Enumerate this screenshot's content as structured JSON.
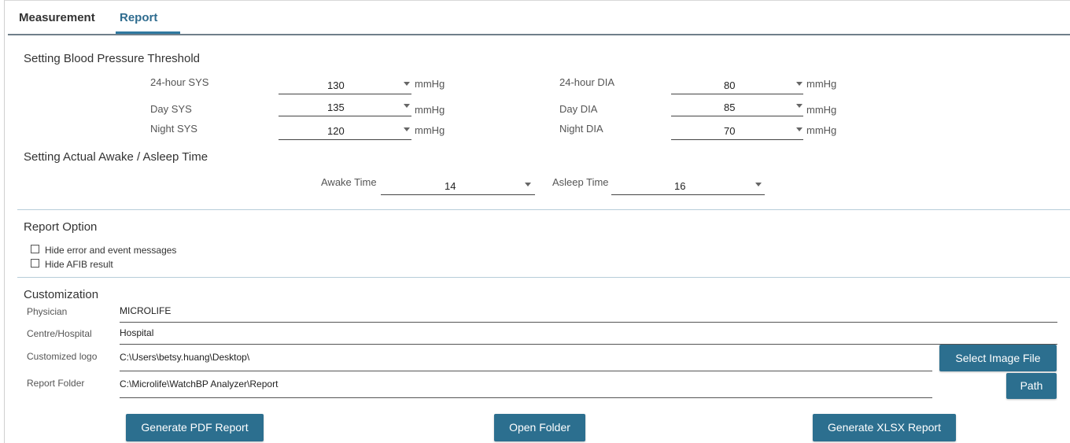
{
  "tabs": [
    {
      "label": "Measurement",
      "active": false
    },
    {
      "label": "Report",
      "active": true
    }
  ],
  "threshold": {
    "title": "Setting Blood Pressure Threshold",
    "unit": "mmHg",
    "rows": [
      {
        "left_label": "24-hour SYS",
        "left_value": "130",
        "right_label": "24-hour DIA",
        "right_value": "80"
      },
      {
        "left_label": "Day SYS",
        "left_value": "135",
        "right_label": "Day DIA",
        "right_value": "85"
      },
      {
        "left_label": "Night SYS",
        "left_value": "120",
        "right_label": "Night DIA",
        "right_value": "70"
      }
    ]
  },
  "awake": {
    "title": "Setting Actual Awake / Asleep Time",
    "awake_label": "Awake Time",
    "awake_value": "14",
    "asleep_label": "Asleep Time",
    "asleep_value": "16"
  },
  "report_option": {
    "title": "Report Option",
    "options": [
      {
        "label": "Hide error and event messages",
        "checked": false
      },
      {
        "label": "Hide AFIB result",
        "checked": false
      }
    ]
  },
  "customization": {
    "title": "Customization",
    "physician_label": "Physician",
    "physician_value": "MICROLIFE",
    "hospital_label": "Centre/Hospital",
    "hospital_value": "Hospital",
    "logo_label": "Customized logo",
    "logo_value": "C:\\Users\\betsy.huang\\Desktop\\",
    "folder_label": "Report Folder",
    "folder_value": "C:\\Microlife\\WatchBP Analyzer\\Report",
    "select_image_button": "Select Image File",
    "path_button": "Path"
  },
  "actions": {
    "generate_pdf": "Generate PDF Report",
    "open_folder": "Open Folder",
    "generate_xlsx": "Generate XLSX Report"
  },
  "colors": {
    "accent": "#2c6f8f",
    "tab_active": "#2f6c8f",
    "divider": "#b7cdd9"
  }
}
